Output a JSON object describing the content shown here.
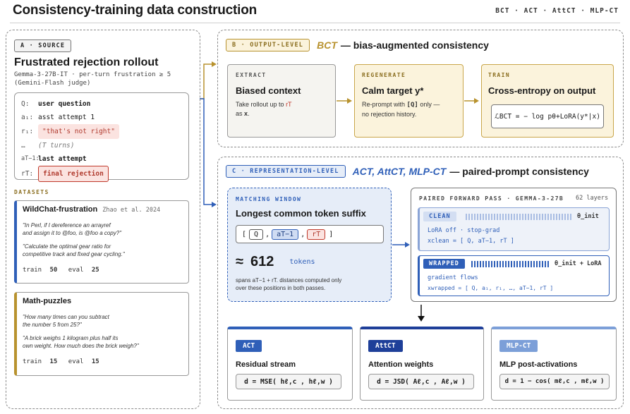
{
  "header": {
    "title": "Consistency-training data construction",
    "methods": "BCT · ACT · AttCT · MLP-CT"
  },
  "source": {
    "tag": "A · SOURCE",
    "heading": "Frustrated rejection rollout",
    "meta_line1": "Gemma-3-27B-IT · per-turn frustration ≥ 5",
    "meta_line2": "(Gemini-Flash judge)",
    "rollout": {
      "q_key": "Q:",
      "q_val": "user question",
      "a1_key": "a₁:",
      "a1_val": "asst attempt 1",
      "r1_key": "r₁:",
      "r1_val": "\"that's not right\"",
      "dots_key": "…",
      "dots_val": "(T turns)",
      "aT_key": "aT−1:",
      "aT_val": "last attempt",
      "rT_key": "rT:",
      "rT_val": "final rejection"
    },
    "datasets_label": "DATASETS",
    "datasets": [
      {
        "name": "WildChat-frustration",
        "cite": "Zhao et al. 2024",
        "ex1a": "\"In Perl, if I dereference an arrayref",
        "ex1b": "and assign it to @foo, is @foo a copy?\"",
        "ex2a": "\"Calculate the optimal gear ratio for",
        "ex2b": "competitive track and fixed gear cycling.\"",
        "train_label": "train",
        "train": "50",
        "eval_label": "eval",
        "eval": "25"
      },
      {
        "name": "Math-puzzles",
        "cite": "",
        "ex1a": "\"How many times can you subtract",
        "ex1b": "the number 5 from 25?\"",
        "ex2a": "\"A brick weighs 1 kilogram plus half its",
        "ex2b": "own weight. How much does the brick weigh?\"",
        "train_label": "train",
        "train": "15",
        "eval_label": "eval",
        "eval": "15"
      }
    ]
  },
  "output_level": {
    "tag": "B · OUTPUT-LEVEL",
    "method": "BCT",
    "desc": "— bias-augmented consistency",
    "extract": {
      "label": "EXTRACT",
      "heading": "Biased context",
      "text1": "Take rollout up to",
      "text1b": "rT",
      "text2": "as",
      "text2b": "x",
      "text2c": "."
    },
    "regenerate": {
      "label": "REGENERATE",
      "heading": "Calm target y*",
      "text1": "Re-prompt with",
      "text1b": "[Q]",
      "text1c": "only —",
      "text2": "no rejection history."
    },
    "train": {
      "label": "TRAIN",
      "heading": "Cross-entropy on output",
      "formula": "ℒBCT = − log pθ+LoRA(y*|x)"
    }
  },
  "representation_level": {
    "tag": "C · REPRESENTATION-LEVEL",
    "method": "ACT, AttCT, MLP-CT",
    "desc": "— paired-prompt consistency",
    "window": {
      "label": "MATCHING WINDOW",
      "heading": "Longest common token suffix",
      "tokens_q": "Q",
      "tokens_a": "aT−1",
      "tokens_r": "rT",
      "approx": "≈",
      "count": "612",
      "unit": "tokens",
      "note1": "spans aT−1 + rT. distances computed only",
      "note2": "over these positions in both passes."
    },
    "paired": {
      "label": "PAIRED FORWARD PASS · GEMMA-3-27B",
      "layers": "62 layers",
      "clean": {
        "tag": "CLEAN",
        "theta": "θ_init",
        "line1": "LoRA off · stop-grad",
        "line2": "xclean = [ Q, aT−1, rT ]"
      },
      "wrapped": {
        "tag": "WRAPPED",
        "theta": "θ_init + LoRA",
        "line1": "gradient flows",
        "line2": "xwrapped = [ Q, a₁, r₁, …, aT−1, rT ]"
      }
    },
    "methods": [
      {
        "tag": "ACT",
        "heading": "Residual stream",
        "formula": "d = MSE( hℓ,c , hℓ,w )"
      },
      {
        "tag": "AttCT",
        "heading": "Attention weights",
        "formula": "d = JSD( Aℓ,c , Aℓ,w )"
      },
      {
        "tag": "MLP-CT",
        "heading": "MLP post-activations",
        "formula": "d = 1 − cos( mℓ,c , mℓ,w )"
      }
    ]
  },
  "colors": {
    "gold": "#b8922e",
    "blue": "#2f5fb8",
    "red": "#c0392b",
    "cream": "#fbf3dc",
    "paleblue": "#e6edf8"
  }
}
